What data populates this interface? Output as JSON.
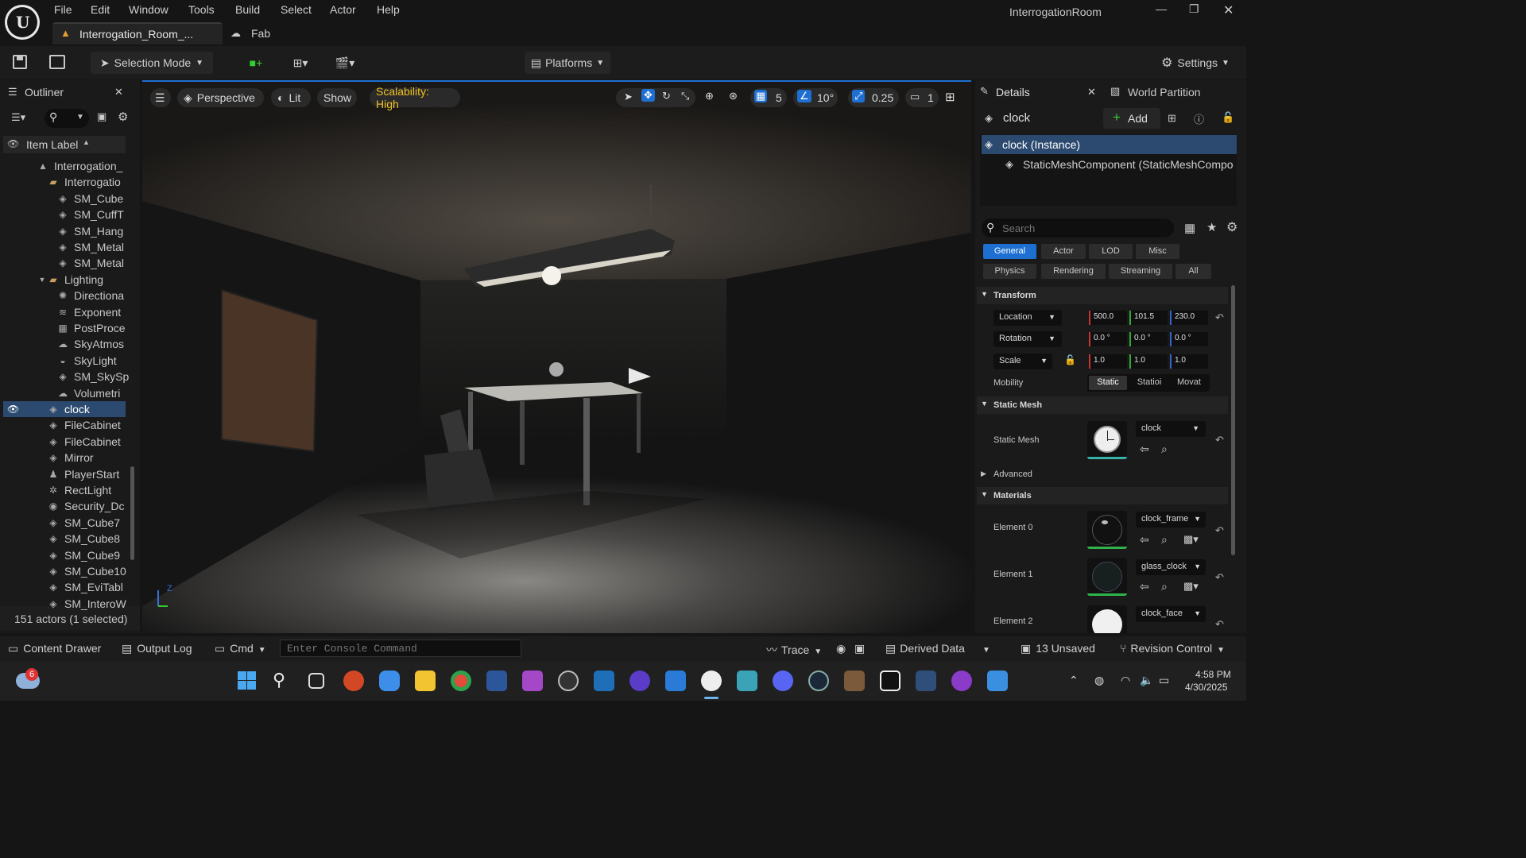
{
  "window": {
    "title": "InterrogationRoom",
    "tabs": [
      {
        "label": "Interrogation_Room_..."
      },
      {
        "label": "Fab"
      }
    ]
  },
  "menu": [
    "File",
    "Edit",
    "Window",
    "Tools",
    "Build",
    "Select",
    "Actor",
    "Help"
  ],
  "toolbar": {
    "mode": "Selection Mode",
    "platforms": "Platforms",
    "settings": "Settings"
  },
  "outliner": {
    "title": "Outliner",
    "column": "Item Label",
    "items": [
      {
        "label": "Interrogation_",
        "icon": "level-icon",
        "depth": 1
      },
      {
        "label": "Interrogatio",
        "icon": "folder-icon",
        "depth": 2
      },
      {
        "label": "SM_Cube",
        "icon": "mesh-icon",
        "depth": 3
      },
      {
        "label": "SM_CuffT",
        "icon": "mesh-icon",
        "depth": 3
      },
      {
        "label": "SM_Hang",
        "icon": "mesh-icon",
        "depth": 3
      },
      {
        "label": "SM_Metal",
        "icon": "mesh-icon",
        "depth": 3
      },
      {
        "label": "SM_Metal",
        "icon": "mesh-icon",
        "depth": 3
      },
      {
        "label": "Lighting",
        "icon": "folder-icon",
        "depth": 2
      },
      {
        "label": "Directiona",
        "icon": "sun-icon",
        "depth": 3
      },
      {
        "label": "Exponent",
        "icon": "fog-icon",
        "depth": 3
      },
      {
        "label": "PostProce",
        "icon": "volume-icon",
        "depth": 3
      },
      {
        "label": "SkyAtmos",
        "icon": "cloud-icon",
        "depth": 3
      },
      {
        "label": "SkyLight",
        "icon": "skylight-icon",
        "depth": 3
      },
      {
        "label": "SM_SkySp",
        "icon": "mesh-icon",
        "depth": 3
      },
      {
        "label": "Volumetri",
        "icon": "cloud-icon",
        "depth": 3
      },
      {
        "label": "clock",
        "icon": "mesh-icon",
        "depth": 2,
        "selected": true
      },
      {
        "label": "FileCabinet",
        "icon": "mesh-icon",
        "depth": 2
      },
      {
        "label": "FileCabinet",
        "icon": "mesh-icon",
        "depth": 2
      },
      {
        "label": "Mirror",
        "icon": "mesh-icon",
        "depth": 2
      },
      {
        "label": "PlayerStart",
        "icon": "player-icon",
        "depth": 2
      },
      {
        "label": "RectLight",
        "icon": "rectlight-icon",
        "depth": 2
      },
      {
        "label": "Security_Dc",
        "icon": "camera-icon",
        "depth": 2
      },
      {
        "label": "SM_Cube7",
        "icon": "mesh-icon",
        "depth": 2
      },
      {
        "label": "SM_Cube8",
        "icon": "mesh-icon",
        "depth": 2
      },
      {
        "label": "SM_Cube9",
        "icon": "mesh-icon",
        "depth": 2
      },
      {
        "label": "SM_Cube10",
        "icon": "mesh-icon",
        "depth": 2
      },
      {
        "label": "SM_EviTabl",
        "icon": "mesh-icon",
        "depth": 2
      },
      {
        "label": "SM_InteroW",
        "icon": "mesh-icon",
        "depth": 2
      }
    ],
    "footer": "151 actors (1 selected)"
  },
  "viewport": {
    "perspective": "Perspective",
    "lit": "Lit",
    "show": "Show",
    "scalability": "Scalability: High",
    "grid": "5",
    "angle": "10°",
    "scale": "0.25",
    "camera": "1"
  },
  "details": {
    "tabs": [
      "Details",
      "World Partition"
    ],
    "actor": "clock",
    "add": "Add",
    "components": [
      "clock (Instance)",
      "StaticMeshComponent (StaticMeshCompo"
    ],
    "search_placeholder": "Search",
    "filters_row1": [
      "General",
      "Actor",
      "LOD",
      "Misc"
    ],
    "filters_row2": [
      "Physics",
      "Rendering",
      "Streaming",
      "All"
    ],
    "transform": {
      "title": "Transform",
      "location": {
        "label": "Location",
        "x": "500.0",
        "y": "101.5",
        "z": "230.0"
      },
      "rotation": {
        "label": "Rotation",
        "x": "0.0 °",
        "y": "0.0 °",
        "z": "0.0 °"
      },
      "scale": {
        "label": "Scale",
        "x": "1.0",
        "y": "1.0",
        "z": "1.0"
      },
      "mobility": {
        "label": "Mobility",
        "options": [
          "Static",
          "Statioi",
          "Movat"
        ]
      }
    },
    "static_mesh": {
      "title": "Static Mesh",
      "label": "Static Mesh",
      "value": "clock",
      "advanced": "Advanced"
    },
    "materials": {
      "title": "Materials",
      "elements": [
        {
          "label": "Element 0",
          "value": "clock_frame"
        },
        {
          "label": "Element 1",
          "value": "glass_clock"
        },
        {
          "label": "Element 2",
          "value": "clock_face"
        }
      ]
    }
  },
  "statusbar": {
    "content_drawer": "Content Drawer",
    "output_log": "Output Log",
    "cmd": "Cmd",
    "console_placeholder": "Enter Console Command",
    "trace": "Trace",
    "derived": "Derived Data",
    "unsaved": "13 Unsaved",
    "revision": "Revision Control"
  },
  "taskbar": {
    "badge": "6",
    "time": "4:58 PM",
    "date": "4/30/2025"
  },
  "colors": {
    "accent": "#1d6fd1",
    "play": "#36b336",
    "selected_row": "#2c4a70",
    "scalability": "#f0c020"
  }
}
